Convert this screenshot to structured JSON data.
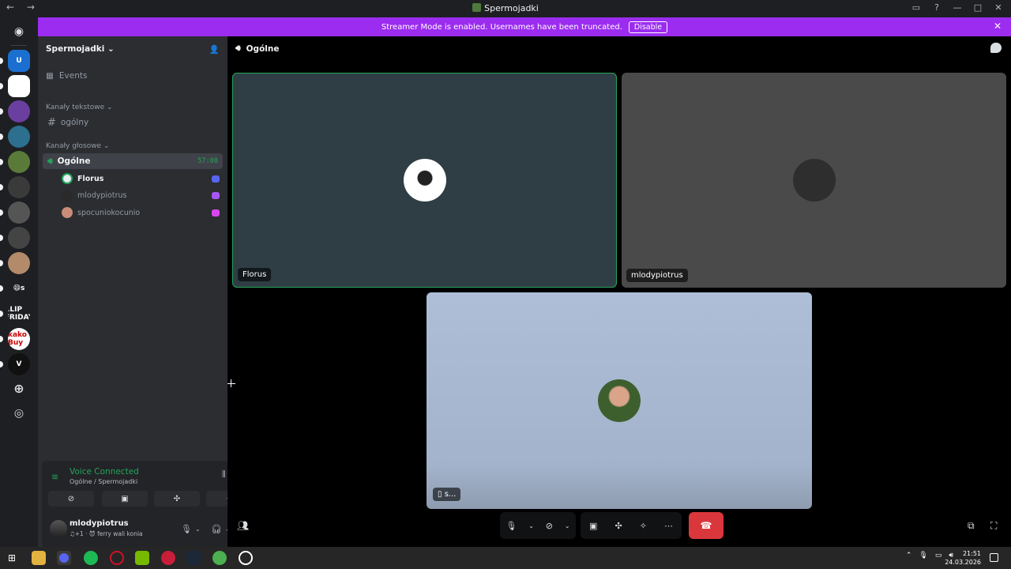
{
  "window": {
    "title": "Spermojadki",
    "nav": "← →"
  },
  "banner": {
    "text": "Streamer Mode is enabled. Usernames have been truncated.",
    "disable_label": "Disable",
    "close": "✕"
  },
  "guilds": [
    {
      "name": "U",
      "color": "#1a6fd1"
    },
    {
      "name": "",
      "color": "#ffffff"
    },
    {
      "name": "",
      "color": "#6b3fa0"
    },
    {
      "name": "",
      "color": "#2c6f8e"
    },
    {
      "name": "",
      "color": "#5a7a3a"
    },
    {
      "name": "",
      "color": "#3a3a3a"
    },
    {
      "name": "",
      "color": "#555555"
    },
    {
      "name": "",
      "color": "#444444"
    },
    {
      "name": "",
      "color": "#b38a6a"
    },
    {
      "name": "😄s",
      "color": "#1e1f22"
    },
    {
      "name": "CLIP FRIDAY",
      "color": "#1e1f22"
    },
    {
      "name": "kako Buy",
      "color": "#ffffff"
    },
    {
      "name": "V",
      "color": "#111111"
    }
  ],
  "sidebar": {
    "server_name": "Spermojadki",
    "events_label": "Events",
    "text_category": "Kanały tekstowe",
    "text_channel": "ogólny",
    "voice_category": "Kanały głosowe",
    "voice_channel": "Ogólne",
    "voice_time": "57:08",
    "voice_users": [
      {
        "name": "Florus",
        "active": true,
        "avatar": "#e8eef2",
        "status": "#5865f2"
      },
      {
        "name": "mlodypiotrus",
        "active": false,
        "avatar": "#2a2a2a",
        "status": "#a855f7"
      },
      {
        "name": "spocuniokocunio",
        "active": false,
        "avatar": "#c98d7a",
        "status": "#d946ef"
      }
    ]
  },
  "voice_panel": {
    "status": "Voice Connected",
    "location": "Ogólne / Spermojadki",
    "username": "mlodypiotrus",
    "activity": "♫+1 · 😈 ferry wali konia"
  },
  "main": {
    "channel_title": "Ogólne",
    "tiles": [
      {
        "label": "Florus",
        "bg": "#2f3e45",
        "avatar": "#ffffff",
        "speaking": true
      },
      {
        "label": "mlodypiotrus",
        "bg": "#4a4a4a",
        "avatar": "#2e2e2e",
        "speaking": false
      },
      {
        "label": "s...",
        "bg": "#a9b9d2",
        "avatar": "#8a6a50",
        "speaking": false
      }
    ]
  },
  "taskbar": {
    "time": "21:51",
    "date": "24.03.2026"
  },
  "colors": {
    "accent": "#9b2cf0",
    "connected": "#23a55a",
    "hangup": "#da373c"
  }
}
